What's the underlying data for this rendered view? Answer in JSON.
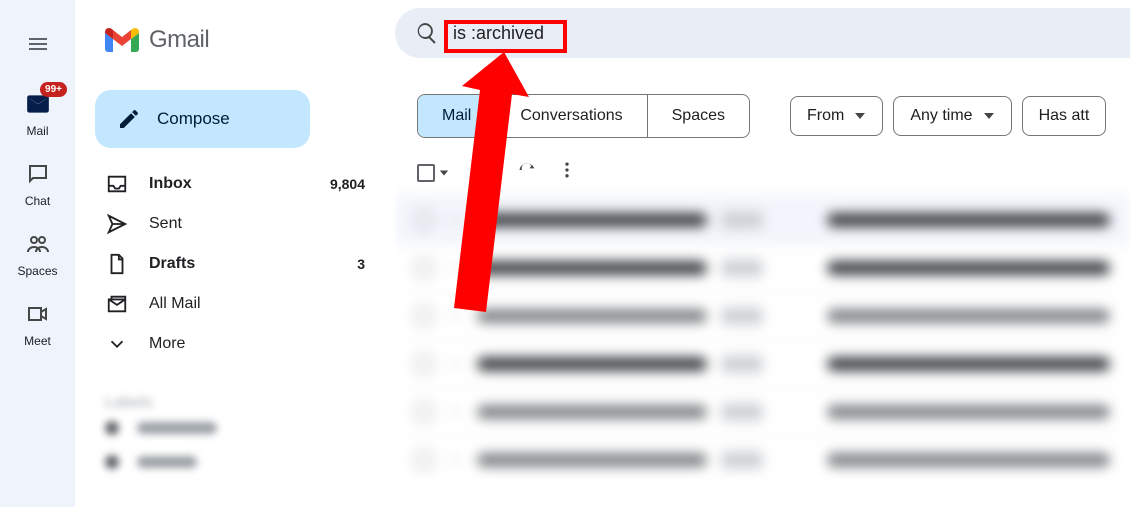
{
  "app": {
    "name": "Gmail"
  },
  "search": {
    "value": "is :archived"
  },
  "rail": {
    "items": [
      {
        "id": "mail",
        "label": "Mail",
        "badge": "99+"
      },
      {
        "id": "chat",
        "label": "Chat"
      },
      {
        "id": "spaces",
        "label": "Spaces"
      },
      {
        "id": "meet",
        "label": "Meet"
      }
    ]
  },
  "compose": {
    "label": "Compose"
  },
  "folders": [
    {
      "id": "inbox",
      "label": "Inbox",
      "count": "9,804",
      "bold": true
    },
    {
      "id": "sent",
      "label": "Sent"
    },
    {
      "id": "drafts",
      "label": "Drafts",
      "count": "3",
      "bold": true
    },
    {
      "id": "allmail",
      "label": "All Mail"
    },
    {
      "id": "more",
      "label": "More"
    }
  ],
  "labels_header": "Labels",
  "segments": {
    "mail": "Mail",
    "conversations": "Conversations",
    "spaces": "Spaces"
  },
  "filters": {
    "from": "From",
    "anytime": "Any time",
    "hasatt": "Has att"
  },
  "annotation": {
    "highlight": "is :archived"
  }
}
